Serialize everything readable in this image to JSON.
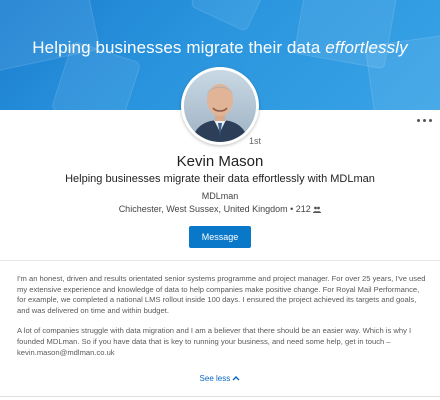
{
  "banner": {
    "text_main": "Helping businesses migrate their data ",
    "text_emphasis": "effortlessly"
  },
  "profile": {
    "avatar_icon": "person-photo",
    "degree": "1st",
    "name": "Kevin Mason",
    "headline": "Helping businesses migrate their data effortlessly with MDLman",
    "company": "MDLman",
    "location": "Chichester, West Sussex, United Kingdom",
    "separator": " • ",
    "connections": "212",
    "connections_icon": "people-icon"
  },
  "actions": {
    "message_label": "Message",
    "more_icon": "more-horizontal-icon"
  },
  "summary": {
    "paragraph_1": "I'm an honest, driven and results orientated senior systems programme and project manager. For over 25 years, I've used my extensive experience and knowledge of data to help companies make positive change. For Royal Mail Performance, for example, we completed a national LMS rollout inside 100 days. I ensured the project achieved its targets and goals, and was delivered on time and within budget.",
    "paragraph_2": "A lot of companies struggle with data migration and I am a believer that there should be an easier way. Which is why I founded MDLman. So if you have data that is key to running your business, and need some help, get in touch – kevin.mason@mdlman.co.uk"
  },
  "toggle": {
    "see_less_label": "See less",
    "chevron_icon": "chevron-up-icon"
  },
  "colors": {
    "banner_blue": "#2a95de",
    "button_blue": "#0a78c9",
    "link_blue": "#0a66c2"
  }
}
